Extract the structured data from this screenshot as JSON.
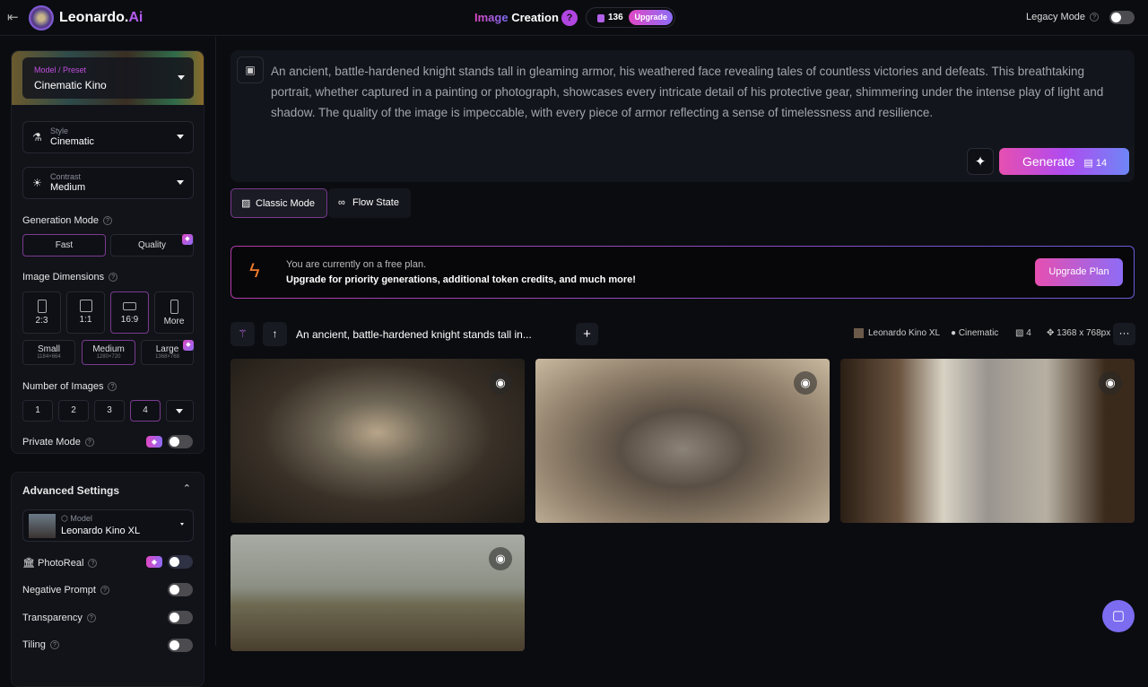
{
  "header": {
    "brand": "Leonardo.",
    "brand_accent": "Ai",
    "title_accent": "Image",
    "title": " Creation",
    "help": "?",
    "tokens": "136",
    "upgrade": "Upgrade",
    "legacy": "Legacy Mode"
  },
  "sidebar": {
    "preset_label": "Model / Preset",
    "preset_value": "Cinematic Kino",
    "style_label": "Style",
    "style_value": "Cinematic",
    "contrast_label": "Contrast",
    "contrast_value": "Medium",
    "gen_mode": "Generation Mode",
    "fast": "Fast",
    "quality": "Quality",
    "dims": "Image Dimensions",
    "ratios": [
      "2:3",
      "1:1",
      "16:9",
      "More"
    ],
    "sizes": [
      {
        "name": "Small",
        "res": "1184×664"
      },
      {
        "name": "Medium",
        "res": "1280×720"
      },
      {
        "name": "Large",
        "res": "1368×768"
      }
    ],
    "num_images": "Number of Images",
    "nums": [
      "1",
      "2",
      "3",
      "4"
    ],
    "private": "Private Mode",
    "advanced": "Advanced Settings",
    "model_label": "Model",
    "model_value": "Leonardo Kino XL",
    "photoreal": "PhotoReal",
    "negative": "Negative Prompt",
    "transparency": "Transparency",
    "tiling": "Tiling"
  },
  "prompt": {
    "text": "An ancient, battle-hardened knight stands tall in gleaming armor, his weathered face revealing tales of countless victories and defeats. This breathtaking portrait, whether captured in a painting or photograph, showcases every intricate detail of his protective gear, shimmering under the intense play of light and shadow. The quality of the image is impeccable, with every piece of armor reflecting a sense of timelessness and resilience.",
    "generate": "Generate",
    "cost": "14"
  },
  "modes": {
    "classic": "Classic Mode",
    "flow": "Flow State"
  },
  "banner": {
    "line1": "You are currently on a free plan.",
    "line2": "Upgrade for priority generations, additional token credits, and much more!",
    "button": "Upgrade Plan"
  },
  "gen_row": {
    "prompt": "An ancient, battle-hardened knight stands tall in...",
    "model": "Leonardo Kino XL",
    "style": "Cinematic",
    "count": "4",
    "size": "1368 x 768px"
  }
}
